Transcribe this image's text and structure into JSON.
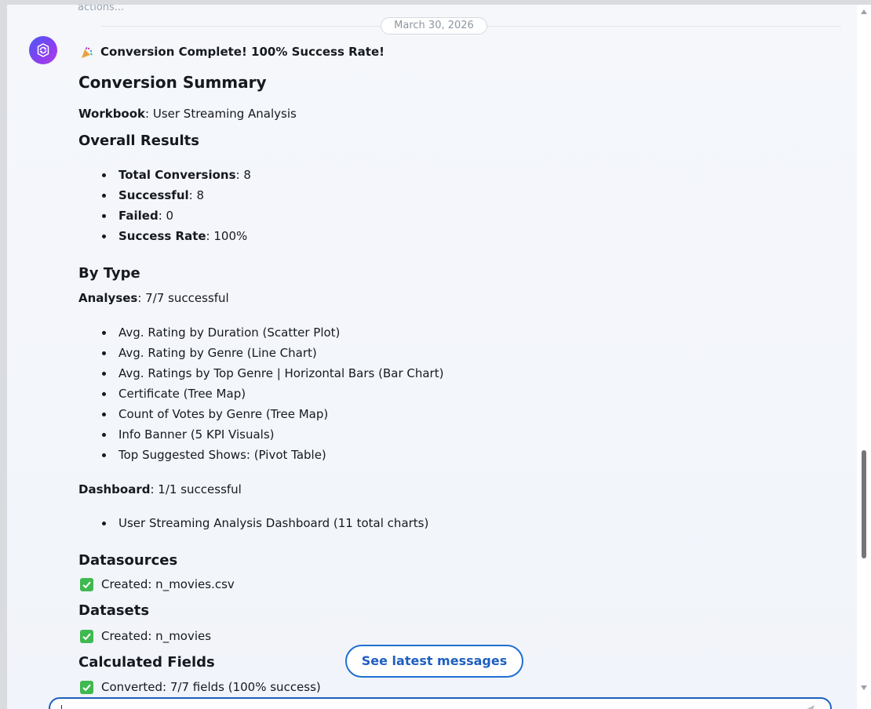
{
  "date_separator": "March 30, 2026",
  "previous_message_fragment": "actions...",
  "message": {
    "headline": "Conversion Complete! 100% Success Rate!",
    "summary_title": "Conversion Summary",
    "workbook": {
      "label": "Workbook",
      "value": ": User Streaming Analysis"
    },
    "overall_results": {
      "title": "Overall Results",
      "items": [
        {
          "label": "Total Conversions",
          "value": ": 8"
        },
        {
          "label": "Successful",
          "value": ": 8"
        },
        {
          "label": "Failed",
          "value": ": 0"
        },
        {
          "label": "Success Rate",
          "value": ": 100%"
        }
      ]
    },
    "by_type": {
      "title": "By Type",
      "analyses": {
        "label": "Analyses",
        "value": ": 7/7 successful",
        "items": [
          "Avg. Rating by Duration (Scatter Plot)",
          "Avg. Rating by Genre (Line Chart)",
          "Avg. Ratings by Top Genre | Horizontal Bars (Bar Chart)",
          "Certificate (Tree Map)",
          "Count of Votes by Genre (Tree Map)",
          "Info Banner (5 KPI Visuals)",
          "Top Suggested Shows: (Pivot Table)"
        ]
      },
      "dashboard": {
        "label": "Dashboard",
        "value": ": 1/1 successful",
        "items": [
          "User Streaming Analysis Dashboard (11 total charts)"
        ]
      }
    },
    "datasources": {
      "title": "Datasources",
      "line": "Created: n_movies.csv"
    },
    "datasets": {
      "title": "Datasets",
      "line": "Created: n_movies"
    },
    "calculated_fields": {
      "title": "Calculated Fields",
      "line": "Converted: 7/7 fields (100% success)"
    }
  },
  "see_latest_button": "See latest messages",
  "scrollbar_position": 0.78,
  "colors": {
    "accent": "#1f5fbf",
    "check": "#3fb950",
    "avatar_from": "#4a59f6",
    "avatar_to": "#b23fe6"
  }
}
